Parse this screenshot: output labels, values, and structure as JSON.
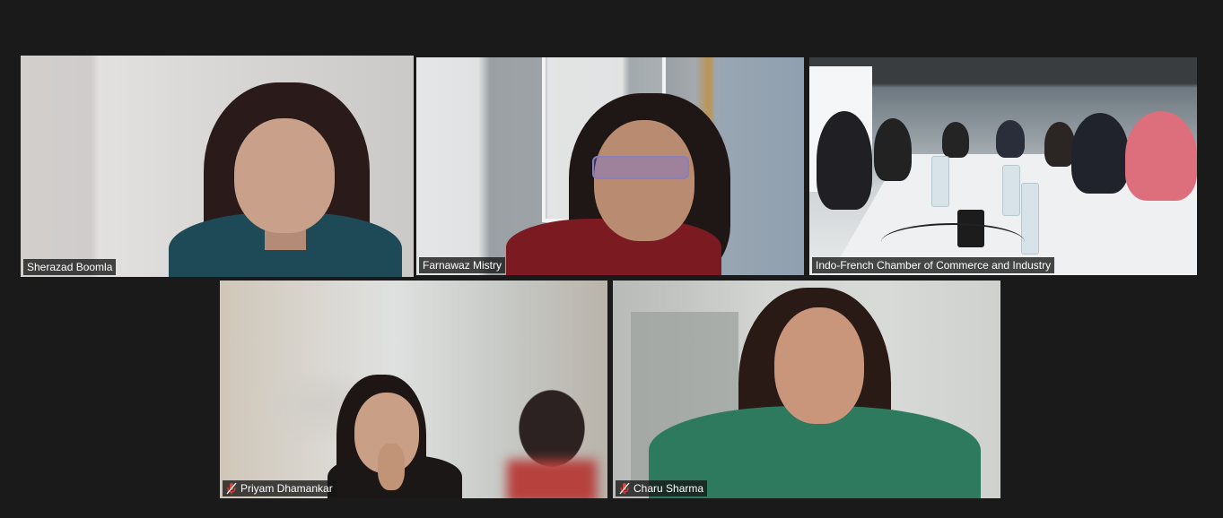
{
  "participants": [
    {
      "name": "Sherazad Boomla",
      "muted": false,
      "active_speaker": true
    },
    {
      "name": "Farnawaz Mistry",
      "muted": false,
      "active_speaker": false
    },
    {
      "name": "Indo-French Chamber of Commerce and Industry",
      "muted": false,
      "active_speaker": false
    },
    {
      "name": "Priyam Dhamankar",
      "muted": true,
      "active_speaker": false
    },
    {
      "name": "Charu Sharma",
      "muted": true,
      "active_speaker": false
    }
  ],
  "colors": {
    "background": "#1a1a1a",
    "active_speaker_border": "#d7ec6f",
    "muted_icon": "#e0403a",
    "name_tag_text": "#ffffff"
  },
  "icons": {
    "muted": "microphone-muted-icon"
  }
}
